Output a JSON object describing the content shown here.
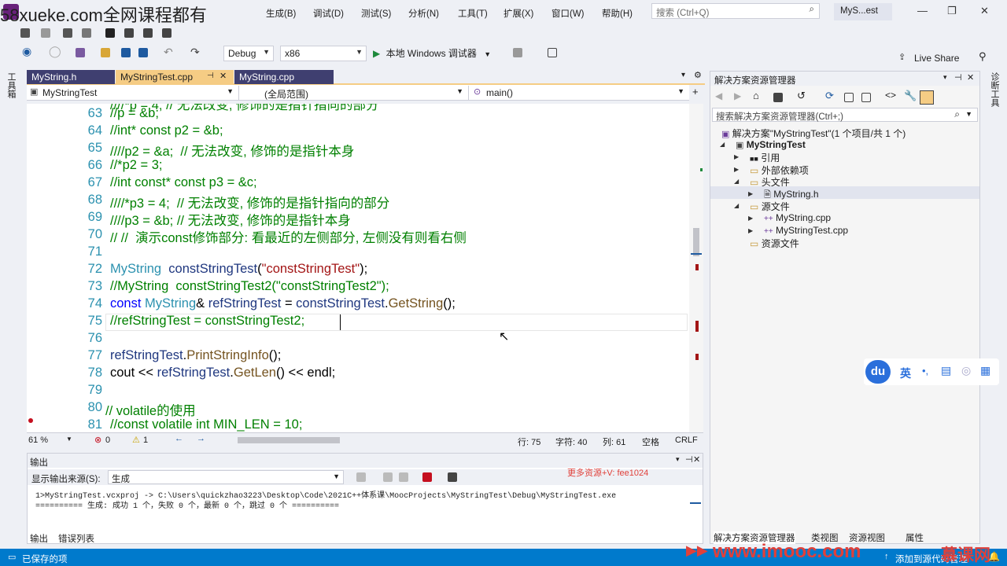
{
  "watermark_top": "58xueke.com全网课程都有",
  "menu": [
    "生成(B)",
    "调试(D)",
    "测试(S)",
    "分析(N)",
    "工具(T)",
    "扩展(X)",
    "窗口(W)",
    "帮助(H)"
  ],
  "search": {
    "placeholder": "搜索 (Ctrl+Q)"
  },
  "project_badge": "MyS...est",
  "live_share": "Live Share",
  "toolbar": {
    "config": "Debug",
    "platform": "x86",
    "run_label": "本地 Windows 调试器"
  },
  "tabs": [
    {
      "label": "MyString.h",
      "active": false
    },
    {
      "label": "MyStringTest.cpp",
      "active": true
    },
    {
      "label": "MyString.cpp",
      "active": false
    }
  ],
  "nav": {
    "project": "MyStringTest",
    "scope": "(全局范围)",
    "func": "main()"
  },
  "left_strip": "工具箱",
  "right_strip": "诊断工具",
  "code_lines": [
    {
      "n": "63",
      "html": "<span class='c-com'>//p = &amp;b;</span>"
    },
    {
      "n": "64",
      "html": "<span class='c-com'>//int* const p2 = &amp;b;</span>"
    },
    {
      "n": "65",
      "html": "<span class='c-com'>////p2 = &amp;a;  // 无法改变, 修饰的是指针本身</span>"
    },
    {
      "n": "66",
      "html": "<span class='c-com'>//*p2 = 3;</span>"
    },
    {
      "n": "67",
      "html": "<span class='c-com'>//int const* const p3 = &amp;c;</span>"
    },
    {
      "n": "68",
      "html": "<span class='c-com'>////*p3 = 4;  // 无法改变, 修饰的是指针指向的部分</span>"
    },
    {
      "n": "69",
      "html": "<span class='c-com'>////p3 = &amp;b; // 无法改变, 修饰的是指针本身</span>"
    },
    {
      "n": "70",
      "html": "<span class='c-com'>// //  演示const修饰部分: 看最近的左侧部分, 左侧没有则看右侧</span>"
    },
    {
      "n": "71",
      "html": ""
    },
    {
      "n": "72",
      "html": "<span class='c-type'>MyString</span>  <span class='c-var'>constStringTest</span>(<span class='c-str'>\"constStringTest\"</span>);"
    },
    {
      "n": "73",
      "html": "<span class='c-com'>//MyString  constStringTest2(\"constStringTest2\");</span>"
    },
    {
      "n": "74",
      "html": "<span class='c-key'>const</span> <span class='c-type'>MyString</span>&amp; <span class='c-var'>refStringTest</span> = <span class='c-var'>constStringTest</span>.<span class='c-fn'>GetString</span>();"
    },
    {
      "n": "75",
      "html": "<span class='c-com'>//refStringTest = constStringTest2;</span>"
    },
    {
      "n": "76",
      "html": ""
    },
    {
      "n": "77",
      "html": "<span class='c-var'>refStringTest</span>.<span class='c-fn'>PrintStringInfo</span>();"
    },
    {
      "n": "78",
      "html": "cout &lt;&lt; <span class='c-var'>refStringTest</span>.<span class='c-fn'>GetLen</span>() &lt;&lt; endl;"
    },
    {
      "n": "79",
      "html": ""
    },
    {
      "n": "80",
      "html": "<span class='c-com'>// volatile的使用</span>"
    },
    {
      "n": "81",
      "html": "<span class='c-com'>//const volatile int MIN_LEN = 10;</span>"
    }
  ],
  "status_editor": {
    "zoom": "61 %",
    "errors": "0",
    "warnings": "1",
    "line": "行: 75",
    "char": "字符: 40",
    "col": "列: 61",
    "space": "空格",
    "eol": "CRLF"
  },
  "output": {
    "title": "输出",
    "source_label": "显示输出来源(S):",
    "source_value": "生成",
    "promo": "更多资源+V: fee1024",
    "line1": "1>MyStringTest.vcxproj -> C:\\Users\\quickzhao3223\\Desktop\\Code\\2021C++体系课\\MoocProjects\\MyStringTest\\Debug\\MyStringTest.exe",
    "line2": "========== 生成: 成功 1 个，失败 0 个，最新 0 个，跳过 0 个 ==========",
    "tabs": [
      "输出",
      "错误列表"
    ]
  },
  "solution": {
    "title": "解决方案资源管理器",
    "search_placeholder": "搜索解决方案资源管理器(Ctrl+;)",
    "root": "解决方案\"MyStringTest\"(1 个项目/共 1 个)",
    "project": "MyStringTest",
    "items": [
      "引用",
      "外部依赖项",
      "头文件",
      "MyString.h",
      "源文件",
      "MyString.cpp",
      "MyStringTest.cpp",
      "资源文件"
    ],
    "bottom_tabs": [
      "解决方案资源管理器",
      "类视图",
      "资源视图",
      "属性"
    ]
  },
  "ime": {
    "logo": "du",
    "lang": "英"
  },
  "statusbar": {
    "left": "已保存的项",
    "right": "添加到源代码管理"
  },
  "imooc": "www.imooc.com",
  "imooc_brand": "慕课网",
  "colors": {
    "accent": "#007acc",
    "tab_active": "#f5cc84",
    "tab_inactive": "#3f3f70",
    "comment": "#008000"
  }
}
